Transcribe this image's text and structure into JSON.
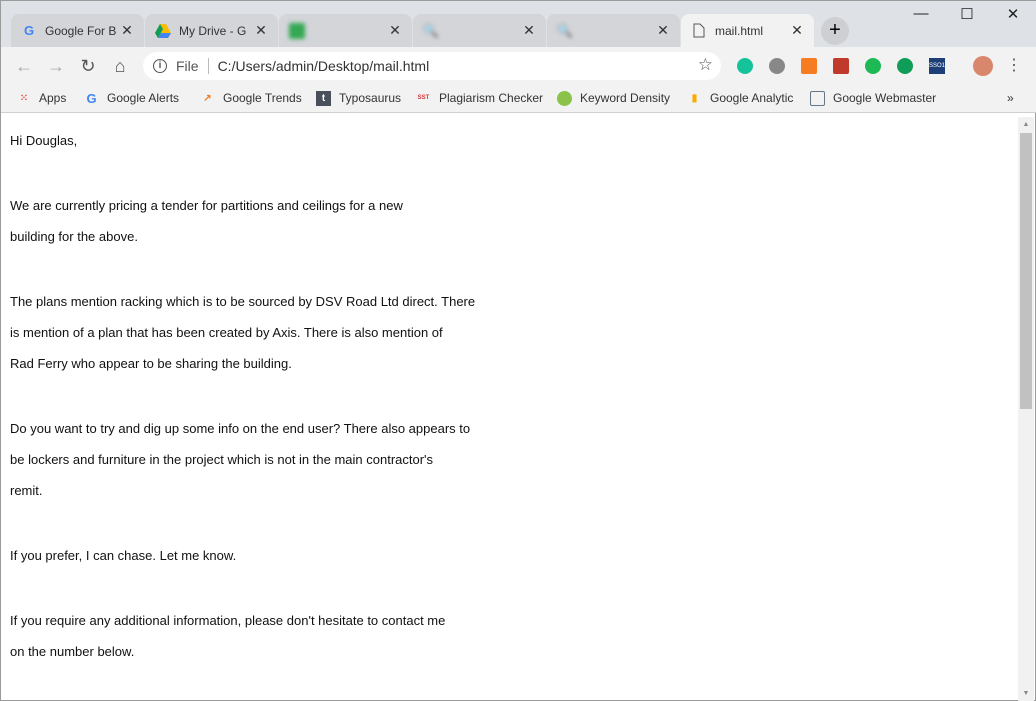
{
  "tabs": [
    {
      "title": "Google For B",
      "icon": "google-icon",
      "blurred": false
    },
    {
      "title": "My Drive - G",
      "icon": "drive-icon",
      "blurred": false
    },
    {
      "title": "",
      "icon": "sheets-icon",
      "blurred": true
    },
    {
      "title": "",
      "icon": "search-icon",
      "blurred": true
    },
    {
      "title": "",
      "icon": "search-icon",
      "blurred": true
    },
    {
      "title": "mail.html",
      "icon": "file-icon",
      "blurred": false,
      "active": true
    }
  ],
  "address": {
    "scheme_label": "File",
    "url": "C:/Users/admin/Desktop/mail.html"
  },
  "bookmarks": [
    {
      "label": "Apps"
    },
    {
      "label": "Google Alerts"
    },
    {
      "label": "Google Trends"
    },
    {
      "label": "Typosaurus"
    },
    {
      "label": "Plagiarism Checker"
    },
    {
      "label": "Keyword Density"
    },
    {
      "label": "Google Analytic"
    },
    {
      "label": "Google Webmaster"
    }
  ],
  "extensions": {
    "sso_label": "SSO1"
  },
  "email": {
    "greeting": "Hi Douglas,",
    "paragraphs": [
      [
        "We are currently pricing a tender for partitions and ceilings for a new",
        "building for the above."
      ],
      [
        "The plans mention racking which is to be sourced by DSV Road Ltd direct. There",
        "is mention of a plan that has been created by Axis. There is also mention of",
        "Rad Ferry who appear to be sharing the building."
      ],
      [
        "Do you want to try and dig up some info on the end user? There also appears to",
        "be lockers and furniture in the project which is not in the main contractor's",
        "remit."
      ],
      [
        "If you prefer, I can chase. Let me know."
      ],
      [
        "If you require any additional information, please don't hesitate to contact me",
        "on the number below."
      ]
    ]
  }
}
